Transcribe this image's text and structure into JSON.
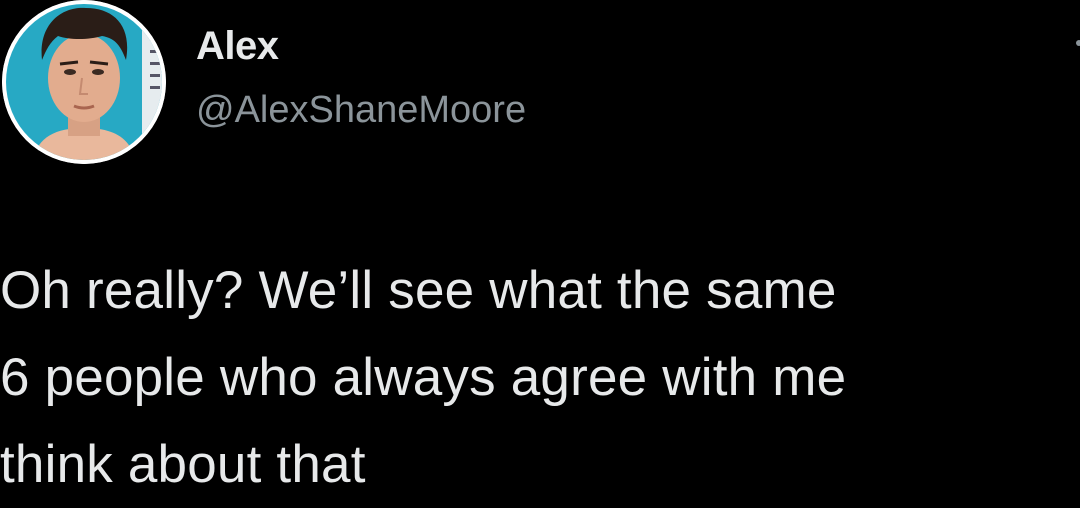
{
  "author": {
    "name": "Alex",
    "handle": "@AlexShaneMoore"
  },
  "tweet": {
    "lines": [
      "Oh really? We’ll see what the same",
      "6 people who always agree with me",
      "think about that"
    ]
  },
  "icons": {
    "avatar": "profile-photo",
    "more": "more-options-icon"
  },
  "colors": {
    "background": "#000000",
    "text": "#e7e9ea",
    "secondary_text": "#8b949a",
    "avatar_backdrop": "#27a9c4"
  }
}
